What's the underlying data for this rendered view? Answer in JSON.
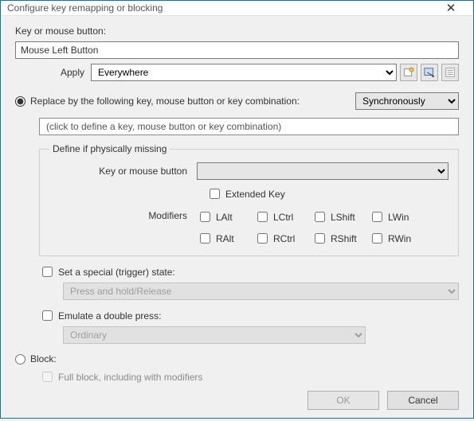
{
  "window": {
    "title": "Configure key remapping or blocking"
  },
  "key_label": "Key or mouse button:",
  "key_value": "Mouse Left Button",
  "apply": {
    "label": "Apply",
    "value": "Everywhere"
  },
  "replace": {
    "radio_label": "Replace by the following key, mouse button or key combination:",
    "sync": "Synchronously",
    "define_placeholder": "(click to define a key, mouse button or key combination)",
    "fieldset_legend": "Define if physically missing",
    "km_label": "Key or mouse button",
    "km_value": "",
    "extended_label": "Extended Key",
    "mods_label": "Modifiers",
    "mods": [
      "LAlt",
      "LCtrl",
      "LShift",
      "LWin",
      "RAlt",
      "RCtrl",
      "RShift",
      "RWin"
    ]
  },
  "trigger": {
    "chk_label": "Set a special (trigger) state:",
    "sel": "Press and hold/Release"
  },
  "double": {
    "chk_label": "Emulate a double press:",
    "sel": "Ordinary"
  },
  "block": {
    "radio_label": "Block:",
    "full_label": "Full block, including with modifiers"
  },
  "buttons": {
    "ok": "OK",
    "cancel": "Cancel"
  }
}
